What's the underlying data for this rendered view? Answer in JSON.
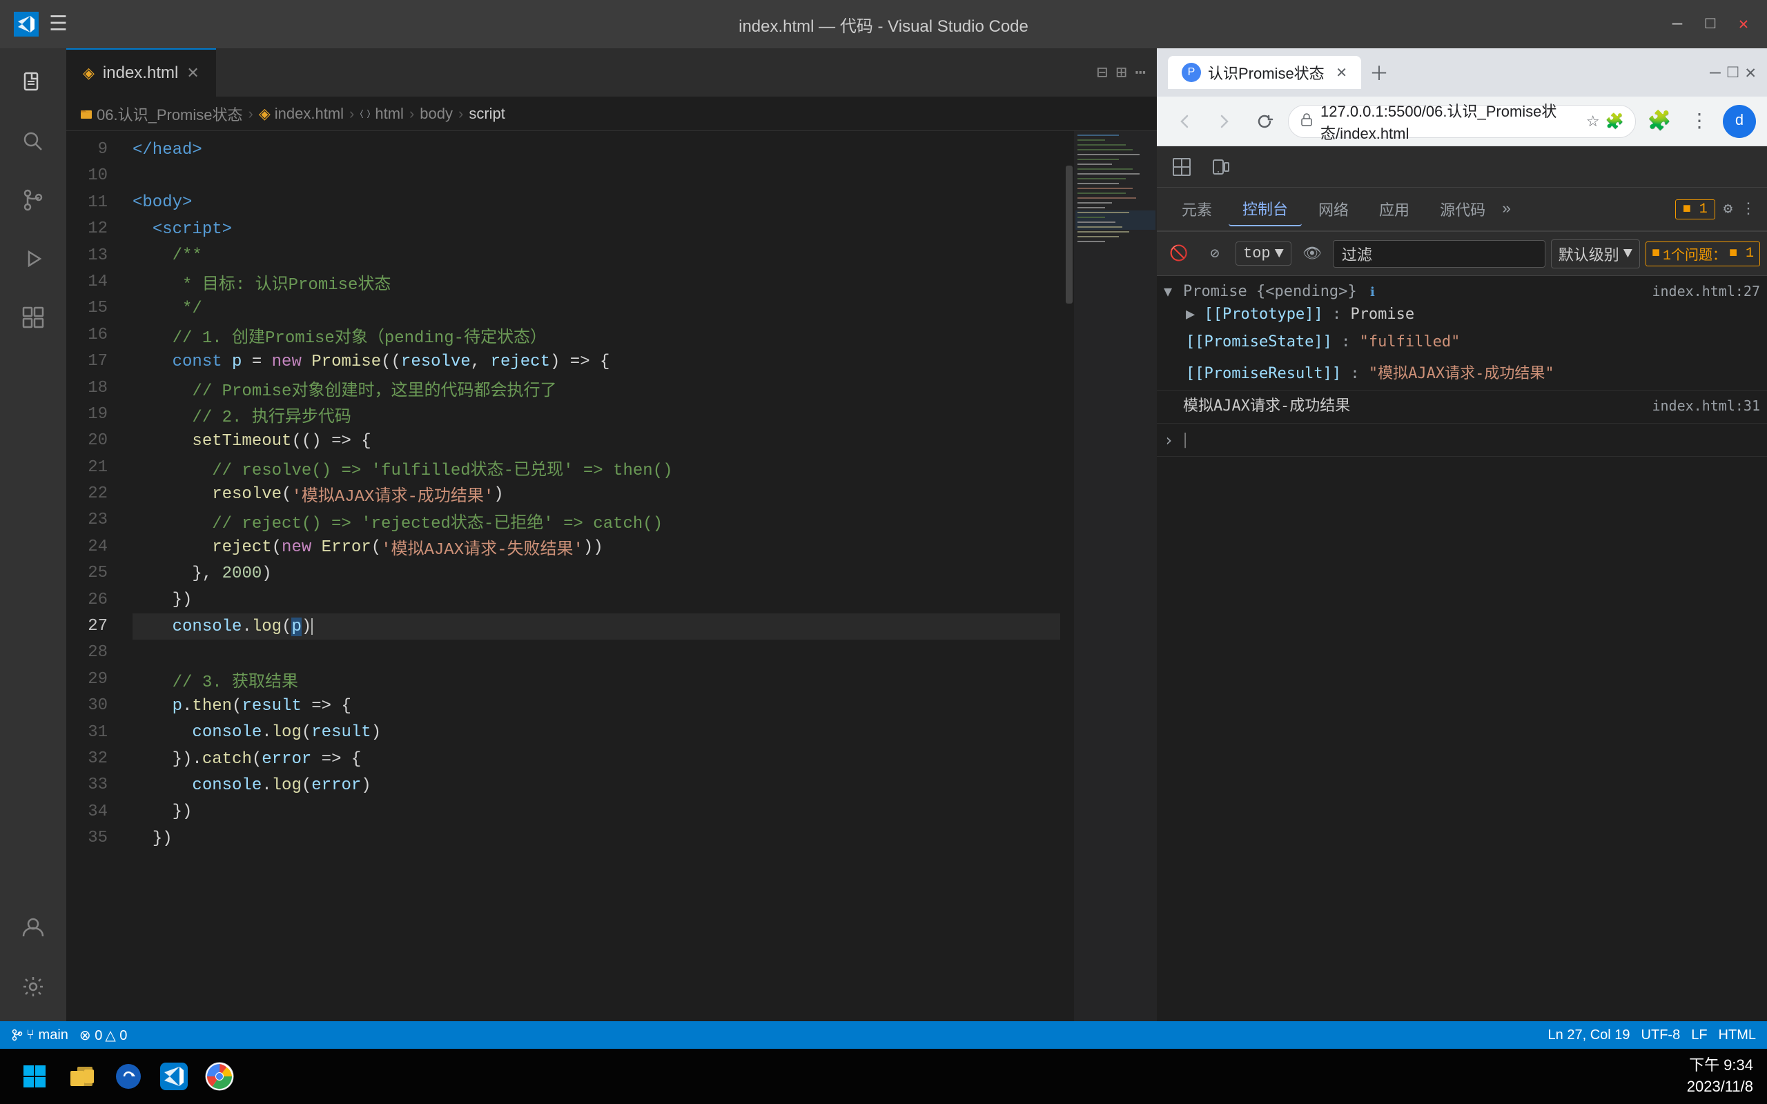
{
  "titlebar": {
    "title": "index.html — 代码 - Visual Studio Code",
    "minimize": "—",
    "maximize": "□",
    "close": "✕"
  },
  "tabs": {
    "editor_tab": "index.html",
    "tab_icon": "◈"
  },
  "breadcrumb": {
    "items": [
      "06.认识_Promise状态",
      "index.html",
      "html",
      "body",
      "script"
    ]
  },
  "code": {
    "lines": [
      {
        "num": "9",
        "content_html": "<span class='c-tag'>&lt;/head&gt;</span>"
      },
      {
        "num": "10",
        "content_html": ""
      },
      {
        "num": "11",
        "content_html": "<span class='c-tag'>&lt;body&gt;</span>"
      },
      {
        "num": "12",
        "content_html": "  <span class='c-tag'>&lt;script&gt;</span>"
      },
      {
        "num": "13",
        "content_html": "    <span class='c-comment'>/**</span>"
      },
      {
        "num": "14",
        "content_html": "    <span class='c-comment'> * 目标: 认识Promise状态</span>"
      },
      {
        "num": "15",
        "content_html": "    <span class='c-comment'> */</span>"
      },
      {
        "num": "16",
        "content_html": "    <span class='c-comment'>// 1. 创建Promise对象（pending-待定状态）</span>"
      },
      {
        "num": "17",
        "content_html": "    <span class='c-const'>const</span> <span class='c-var'>p</span> = <span class='c-keyword'>new</span> <span class='c-fn'>Promise</span><span class='c-punct'>((</span><span class='c-param'>resolve</span>, <span class='c-param'>reject</span><span class='c-punct'>)</span> <span class='c-arrow'>=&gt;</span> <span class='c-punct'>{</span>"
      },
      {
        "num": "18",
        "content_html": "      <span class='c-comment'>// Promise对象创建时，这里的代码都会执行了</span>"
      },
      {
        "num": "19",
        "content_html": "      <span class='c-comment'>// 2. 执行异步代码</span>"
      },
      {
        "num": "20",
        "content_html": "      <span class='c-fn'>setTimeout</span><span class='c-punct'>(() =&gt; {</span>"
      },
      {
        "num": "21",
        "content_html": "        <span class='c-comment'>// resolve() =&gt; 'fulfilled状态-已兑现' =&gt; then()</span>"
      },
      {
        "num": "22",
        "content_html": "        <span class='c-fn'>resolve</span><span class='c-punct'>(</span><span class='c-str'>'模拟AJAX请求-成功结果'</span><span class='c-punct'>)</span>"
      },
      {
        "num": "23",
        "content_html": "        <span class='c-comment'>// reject() =&gt; 'rejected状态-已拒绝' =&gt; catch()</span>"
      },
      {
        "num": "24",
        "content_html": "        <span class='c-fn'>reject</span><span class='c-punct'>(</span><span class='c-keyword'>new</span> <span class='c-fn'>Error</span><span class='c-punct'>(</span><span class='c-str'>'模拟AJAX请求-失败结果'</span><span class='c-punct'>))</span>"
      },
      {
        "num": "25",
        "content_html": "      <span class='c-punct'>}, </span><span class='c-num'>2000</span><span class='c-punct'>)</span>"
      },
      {
        "num": "26",
        "content_html": "    <span class='c-punct'>})</span>"
      },
      {
        "num": "27",
        "content_html": "    <span class='c-var'>console</span>.<span class='c-method'>log</span><span class='c-punct'>(</span><span class='c-var highlight'>p</span><span class='c-punct'>)</span><span class='cursor'></span>",
        "active": true
      },
      {
        "num": "28",
        "content_html": ""
      },
      {
        "num": "29",
        "content_html": "    <span class='c-comment'>// 3. 获取结果</span>"
      },
      {
        "num": "30",
        "content_html": "    <span class='c-var'>p</span>.<span class='c-method'>then</span><span class='c-punct'>(</span><span class='c-param'>result</span> <span class='c-arrow'>=&gt;</span> <span class='c-punct'>{</span>"
      },
      {
        "num": "31",
        "content_html": "      <span class='c-var'>console</span>.<span class='c-method'>log</span><span class='c-punct'>(</span><span class='c-param'>result</span><span class='c-punct'>)</span>"
      },
      {
        "num": "32",
        "content_html": "    <span class='c-punct'>}).</span><span class='c-method'>catch</span><span class='c-punct'>(</span><span class='c-param'>error</span> <span class='c-arrow'>=&gt;</span> <span class='c-punct'>{</span>"
      },
      {
        "num": "33",
        "content_html": "      <span class='c-var'>console</span>.<span class='c-method'>log</span><span class='c-punct'>(</span><span class='c-param'>error</span><span class='c-punct'>)</span>"
      },
      {
        "num": "34",
        "content_html": "    <span class='c-punct'>})</span>"
      },
      {
        "num": "35",
        "content_html": "  <span class='c-punct'>})</span>"
      }
    ]
  },
  "browser": {
    "tab_title": "认识Promise状态",
    "url": "127.0.0.1:5500/06.认识_Promise状态/index.html",
    "devtools": {
      "tabs": [
        "元素",
        "控制台",
        "网络",
        "应用",
        "源代码"
      ],
      "active_tab": "控制台",
      "more": "»",
      "right_items": [
        "■1",
        "⚙",
        "⋮"
      ],
      "console": {
        "top_label": "top",
        "filter_placeholder": "过滤",
        "log_level": "默认级别",
        "issue_label": "1个问题",
        "issue_badge": "■1"
      },
      "output": [
        {
          "type": "promise",
          "expand": "▶",
          "text": "Promise {<pending>}",
          "location": "index.html:27",
          "expanded": true,
          "children": [
            {
              "key": "[[Prototype]]",
              "value": "Promise"
            },
            {
              "key": "[[PromiseState]]",
              "value": "\"fulfilled\""
            },
            {
              "key": "[[PromiseResult]]",
              "value": "\"模拟AJAX请求-成功结果\""
            }
          ]
        },
        {
          "type": "text",
          "text": "模拟AJAX请求-成功结果",
          "location": "index.html:31"
        }
      ]
    }
  },
  "statusbar": {
    "git": "⑂ main",
    "errors": "⊗ 0",
    "warnings": "△ 0",
    "file_type": "HTML",
    "encoding": "UTF-8",
    "line_ending": "LF",
    "position": "Ln 27, Col 19"
  },
  "taskbar": {
    "time": "下午 9:34",
    "date": "2023/11/8"
  },
  "icons": {
    "vscode": "{ }",
    "explorer": "📄",
    "search": "🔍",
    "git": "⑂",
    "debug": "⏵",
    "extensions": "⊞",
    "account": "👤",
    "settings": "⚙",
    "back": "←",
    "forward": "→",
    "refresh": "↻",
    "shield": "🔒"
  }
}
